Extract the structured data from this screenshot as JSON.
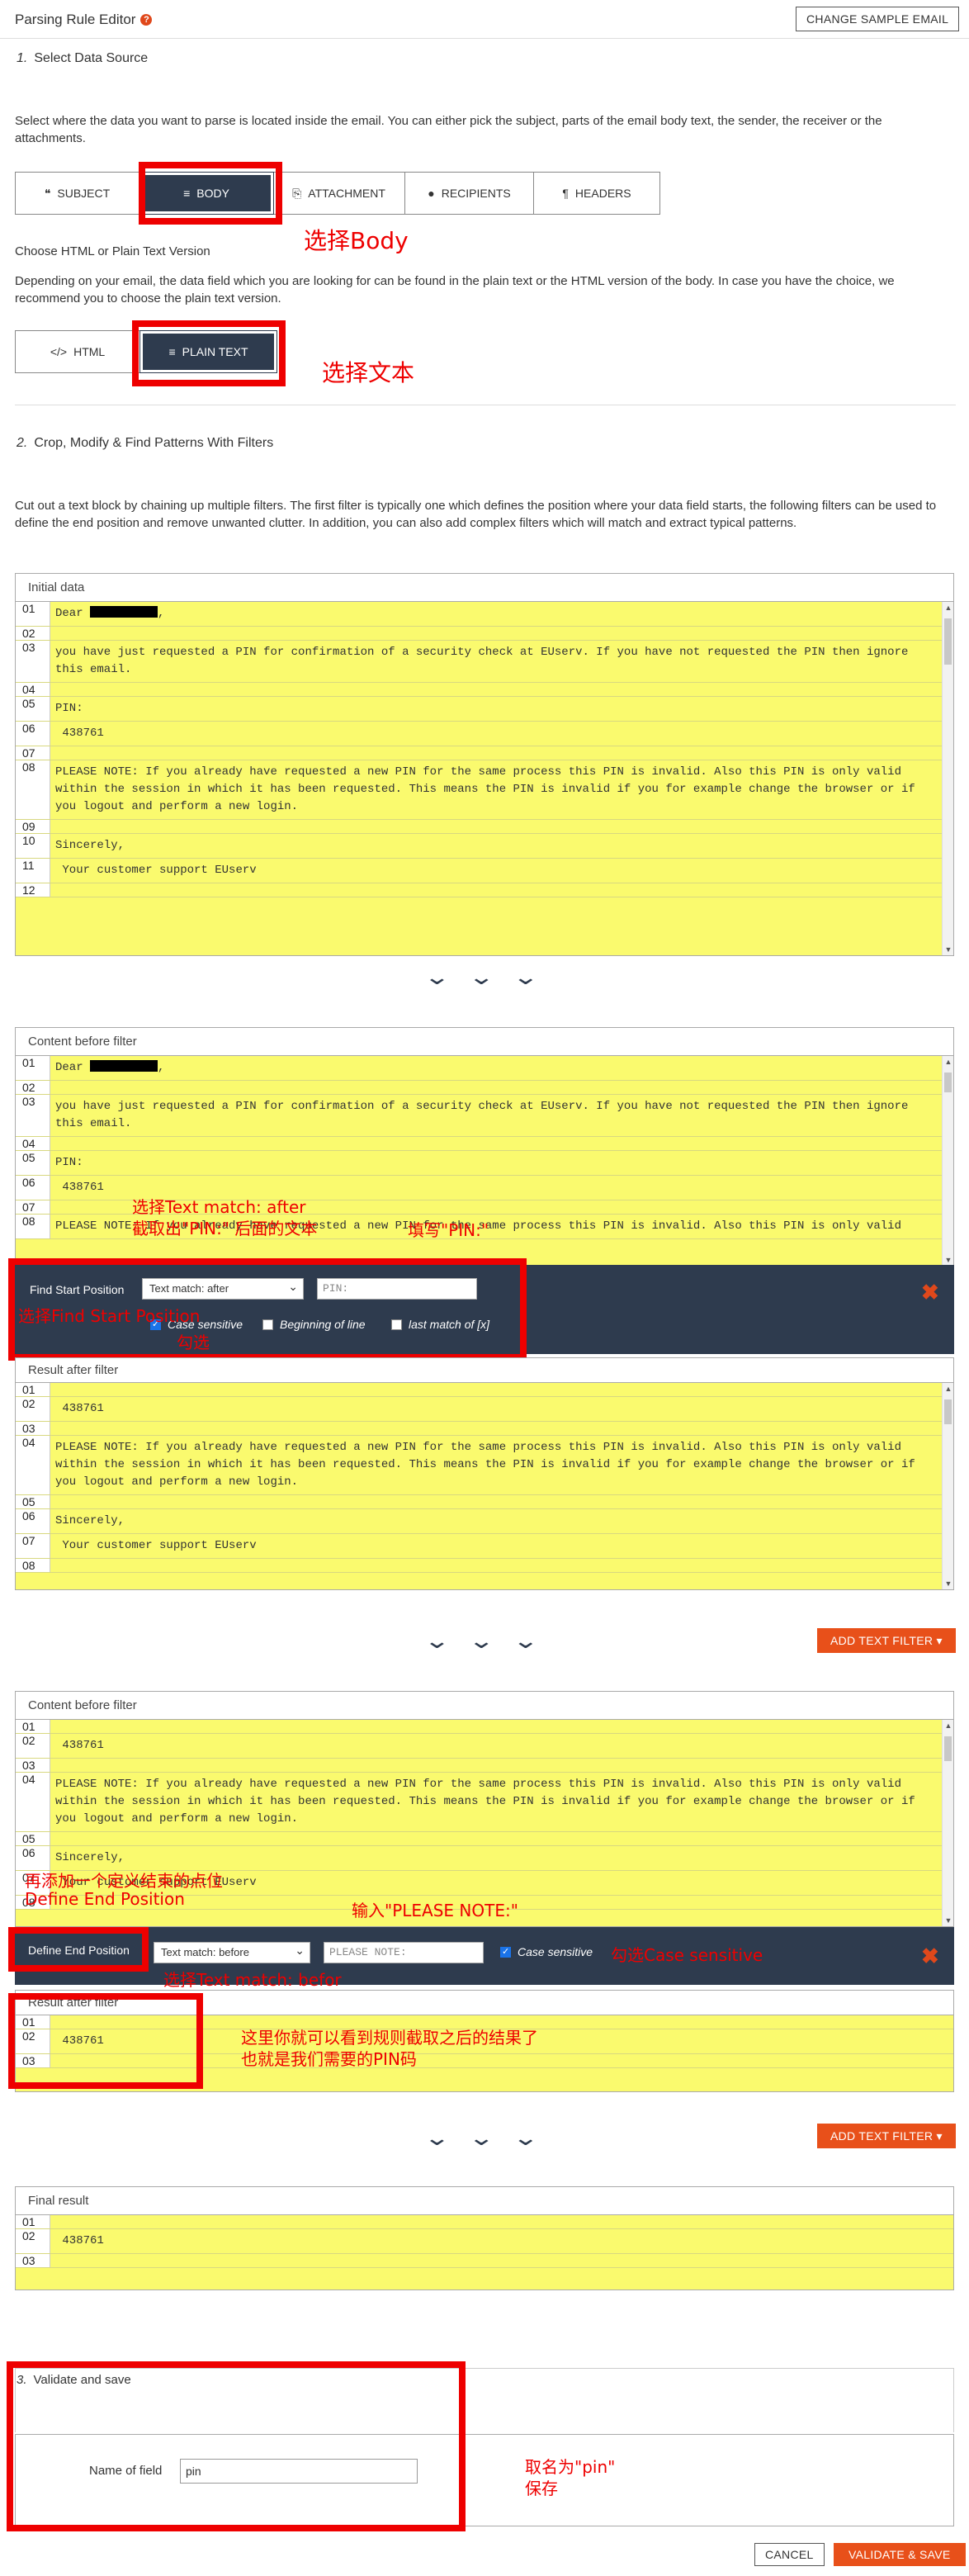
{
  "header": {
    "title": "Parsing Rule Editor",
    "help_icon": "?",
    "change_sample_label": "CHANGE SAMPLE EMAIL"
  },
  "section1": {
    "num": "1.",
    "title": "Select Data Source",
    "desc": "Select where the data you want to parse is located inside the email. You can either pick the subject, parts of the email body text, the sender, the receiver or the attachments.",
    "tabs": [
      {
        "icon": "❝",
        "label": "SUBJECT"
      },
      {
        "icon": "≡",
        "label": "BODY"
      },
      {
        "icon": "⎘",
        "label": "ATTACHMENT"
      },
      {
        "icon": "●",
        "label": "RECIPIENTS"
      },
      {
        "icon": "¶",
        "label": "HEADERS"
      }
    ],
    "choose_title": "Choose HTML or Plain Text Version",
    "choose_desc": "Depending on your email, the data field which you are looking for can be found in the plain text or the HTML version of the body. In case you have the choice, we recommend you to choose the plain text version.",
    "format_tabs": [
      {
        "icon": "</>",
        "label": "HTML"
      },
      {
        "icon": "≡",
        "label": "PLAIN TEXT"
      }
    ]
  },
  "section2": {
    "num": "2.",
    "title": "Crop, Modify & Find Patterns With Filters",
    "desc": "Cut out a text block by chaining up multiple filters. The first filter is typically one which defines the position where your data field starts, the following filters can be used to define the end position and remove unwanted clutter. In addition, you can also add complex filters which will match and extract typical patterns."
  },
  "panels": {
    "initial": {
      "title": "Initial data",
      "lines": [
        {
          "n": "01",
          "t": "Dear "
        },
        {
          "n": "02",
          "t": ""
        },
        {
          "n": "03",
          "t": "you have just requested a PIN for confirmation of a security check at EUserv. If you have not requested the PIN then ignore this email."
        },
        {
          "n": "04",
          "t": ""
        },
        {
          "n": "05",
          "t": "PIN:"
        },
        {
          "n": "06",
          "t": " 438761"
        },
        {
          "n": "07",
          "t": ""
        },
        {
          "n": "08",
          "t": "PLEASE NOTE: If you already have requested a new PIN for the same process this PIN is invalid. Also this PIN is only valid within the session in which it has been requested. This means the PIN is invalid if you for example change the browser or if you logout and perform a new login."
        },
        {
          "n": "09",
          "t": ""
        },
        {
          "n": "10",
          "t": "Sincerely,"
        },
        {
          "n": "11",
          "t": " Your customer support EUserv"
        },
        {
          "n": "12",
          "t": ""
        }
      ]
    },
    "before1": {
      "title": "Content before filter",
      "lines": [
        {
          "n": "01",
          "t": "Dear "
        },
        {
          "n": "02",
          "t": ""
        },
        {
          "n": "03",
          "t": "you have just requested a PIN for confirmation of a security check at EUserv. If you have not requested the PIN then ignore this email."
        },
        {
          "n": "04",
          "t": ""
        },
        {
          "n": "05",
          "t": "PIN:"
        },
        {
          "n": "06",
          "t": " 438761"
        },
        {
          "n": "07",
          "t": ""
        },
        {
          "n": "08",
          "t": "PLEASE NOTE: If you already have requested a new PIN for the same process this PIN is invalid. Also this PIN is only valid"
        }
      ]
    },
    "after1": {
      "title": "Result after filter",
      "lines": [
        {
          "n": "01",
          "t": ""
        },
        {
          "n": "02",
          "t": " 438761"
        },
        {
          "n": "03",
          "t": ""
        },
        {
          "n": "04",
          "t": "PLEASE NOTE: If you already have requested a new PIN for the same process this PIN is invalid. Also this PIN is only valid within the session in which it has been requested. This means the PIN is invalid if you for example change the browser or if you logout and perform a new login."
        },
        {
          "n": "05",
          "t": ""
        },
        {
          "n": "06",
          "t": "Sincerely,"
        },
        {
          "n": "07",
          "t": " Your customer support EUserv"
        },
        {
          "n": "08",
          "t": ""
        }
      ]
    },
    "before2": {
      "title": "Content before filter",
      "lines": [
        {
          "n": "01",
          "t": ""
        },
        {
          "n": "02",
          "t": " 438761"
        },
        {
          "n": "03",
          "t": ""
        },
        {
          "n": "04",
          "t": "PLEASE NOTE: If you already have requested a new PIN for the same process this PIN is invalid. Also this PIN is only valid within the session in which it has been requested. This means the PIN is invalid if you for example change the browser or if you logout and perform a new login."
        },
        {
          "n": "05",
          "t": ""
        },
        {
          "n": "06",
          "t": "Sincerely,"
        },
        {
          "n": "07",
          "t": " Your customer support EUserv"
        },
        {
          "n": "08",
          "t": ""
        }
      ]
    },
    "after2": {
      "title": "Result after filter",
      "lines": [
        {
          "n": "01",
          "t": ""
        },
        {
          "n": "02",
          "t": " 438761"
        },
        {
          "n": "03",
          "t": ""
        }
      ]
    },
    "final": {
      "title": "Final result",
      "lines": [
        {
          "n": "01",
          "t": ""
        },
        {
          "n": "02",
          "t": " 438761"
        },
        {
          "n": "03",
          "t": ""
        }
      ]
    }
  },
  "filter1": {
    "label": "Find Start Position",
    "select": "Text match: after",
    "input": "PIN:",
    "opts": [
      "Case sensitive",
      "Beginning of line",
      "last match of [x]"
    ]
  },
  "filter2": {
    "label": "Define End Position",
    "select": "Text match: before",
    "input": "PLEASE NOTE:",
    "opts": [
      "Case sensitive"
    ]
  },
  "add_filter_label": "ADD TEXT FILTER ▾",
  "chevrons": "⌄⌄⌄",
  "section3": {
    "num": "3.",
    "title": "Validate and save",
    "field_label": "Name of field",
    "field_value": "pin"
  },
  "footer": {
    "cancel": "CANCEL",
    "save": "VALIDATE & SAVE"
  },
  "annotations": {
    "a_body": "选择Body",
    "a_plain": "选择文本",
    "a_textmatch": "选择Text match: after",
    "a_crop": "截取出\"PIN:\" 后面的文本",
    "a_fill": "填写\"PIN:\"",
    "a_findstart": "选择Find Start Position",
    "a_check": "勾选",
    "a_add1": "再添加一个定义结束的点位",
    "a_add2": "Define End Position",
    "a_input2": "输入\"PLEASE NOTE:\"",
    "a_case": "勾选Case sensitive",
    "a_before": "选择Text match: befor",
    "a_result1": "这里你就可以看到规则截取之后的结果了",
    "a_result2": "也就是我们需要的PIN码",
    "a_name1": "取名为\"pin\"",
    "a_name2": "保存"
  }
}
